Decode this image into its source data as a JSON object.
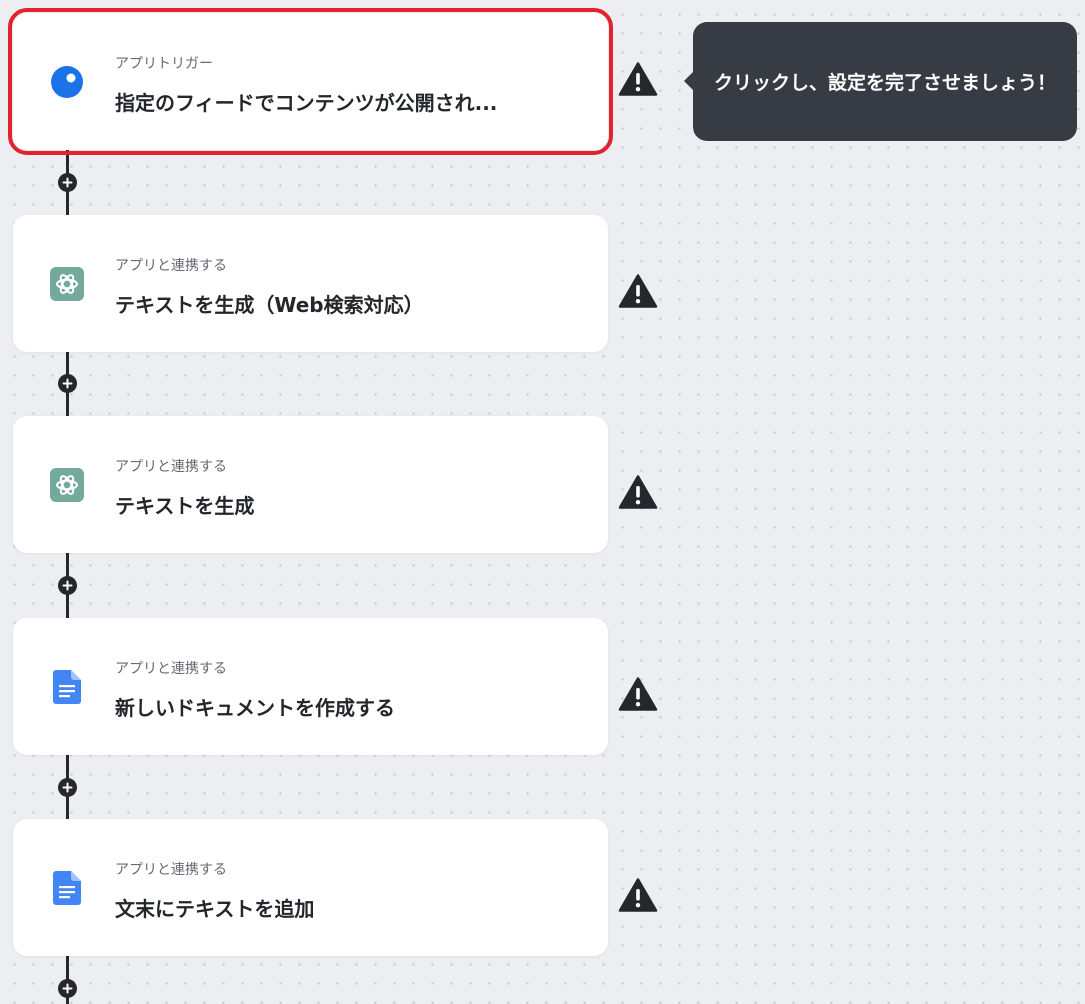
{
  "steps": [
    {
      "subtitle": "アプリトリガー",
      "title": "指定のフィードでコンテンツが公開され...",
      "icon": "rss-trigger-icon",
      "status": "warning",
      "selected": true
    },
    {
      "subtitle": "アプリと連携する",
      "title": "テキストを生成（Web検索対応）",
      "icon": "chatgpt-icon",
      "status": "warning"
    },
    {
      "subtitle": "アプリと連携する",
      "title": "テキストを生成",
      "icon": "chatgpt-icon",
      "status": "warning"
    },
    {
      "subtitle": "アプリと連携する",
      "title": "新しいドキュメントを作成する",
      "icon": "google-docs-icon",
      "status": "warning"
    },
    {
      "subtitle": "アプリと連携する",
      "title": "文末にテキストを追加",
      "icon": "google-docs-icon",
      "status": "warning"
    }
  ],
  "tooltip": {
    "text": "クリックし、設定を完了させましょう！"
  },
  "colors": {
    "selected_outline": "#e2232f",
    "trigger_blue": "#1a73e8",
    "chatgpt_green": "#74aa9c",
    "docs_blue": "#4285f4",
    "connector": "#24272c",
    "tooltip_bg": "#373c44"
  }
}
